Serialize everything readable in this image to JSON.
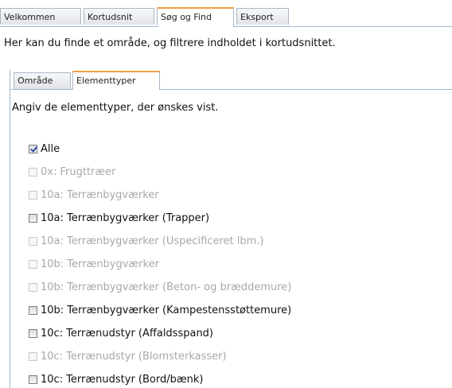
{
  "top_tabs": [
    {
      "label": "Velkommen",
      "active": false
    },
    {
      "label": "Kortudsnit",
      "active": false
    },
    {
      "label": "Søg og Find",
      "active": true
    },
    {
      "label": "Eksport",
      "active": false
    }
  ],
  "intro_text": "Her kan du finde et område, og filtrere indholdet i kortudsnittet.",
  "sub_tabs": [
    {
      "label": "Område",
      "active": false
    },
    {
      "label": "Elementtyper",
      "active": true
    }
  ],
  "prompt_text": "Angiv de elementtyper, der ønskes vist.",
  "element_types": [
    {
      "label": "Alle",
      "checked": true,
      "enabled": true
    },
    {
      "label": "0x: Frugttræer",
      "checked": false,
      "enabled": false
    },
    {
      "label": "10a: Terrænbygværker",
      "checked": false,
      "enabled": false
    },
    {
      "label": "10a: Terrænbygværker (Trapper)",
      "checked": false,
      "enabled": true
    },
    {
      "label": "10a: Terrænbygværker (Uspecificeret lbm.)",
      "checked": false,
      "enabled": false
    },
    {
      "label": "10b: Terrænbygværker",
      "checked": false,
      "enabled": false
    },
    {
      "label": "10b: Terrænbygværker (Beton- og bræddemure)",
      "checked": false,
      "enabled": false
    },
    {
      "label": "10b: Terrænbygværker (Kampestensstøttemure)",
      "checked": false,
      "enabled": true
    },
    {
      "label": "10c: Terrænudstyr (Affaldsspand)",
      "checked": false,
      "enabled": true
    },
    {
      "label": "10c: Terrænudstyr (Blomsterkasser)",
      "checked": false,
      "enabled": false
    },
    {
      "label": "10c: Terrænudstyr (Bord/bænk)",
      "checked": false,
      "enabled": true
    }
  ],
  "colors": {
    "active_tab_accent": "#f0a040",
    "border": "#9fb6cf",
    "disabled_text": "#a8a8a8",
    "checkmark": "#2a4fa8"
  }
}
